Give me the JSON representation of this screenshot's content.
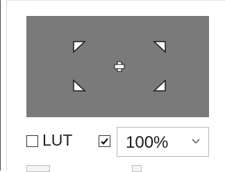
{
  "preview": {
    "background": "#7a7a7a",
    "marker_fill": "#ffffff",
    "marker_stroke": "#1a1a1a",
    "corner_icons": [
      "crop-corner-top-left",
      "crop-corner-top-right",
      "crop-corner-bottom-left",
      "crop-corner-bottom-right"
    ],
    "center_icon": "crosshair-plus"
  },
  "controls": {
    "lut_checkbox": {
      "label": "LUT",
      "checked": false
    },
    "second_checkbox": {
      "checked": true
    },
    "zoom": {
      "value": "100%",
      "icon": "chevron-down"
    }
  }
}
